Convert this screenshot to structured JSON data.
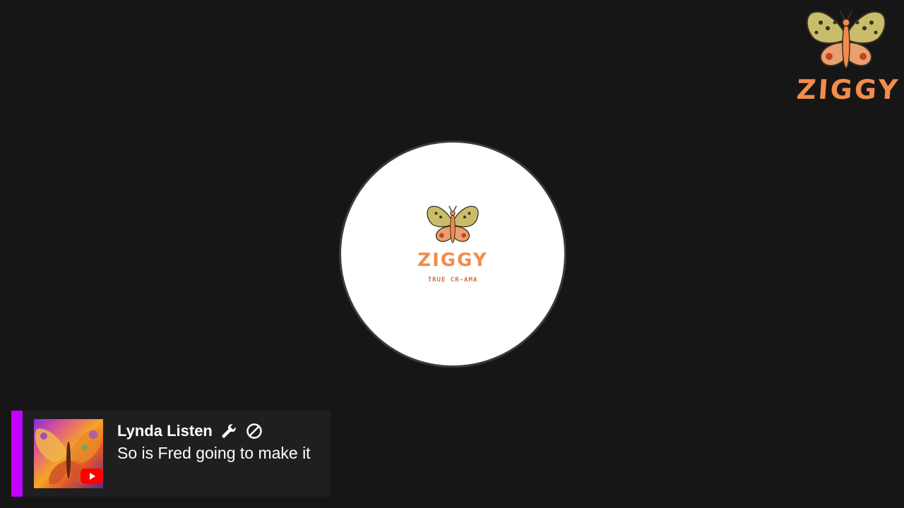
{
  "colors": {
    "background": "#171616",
    "brand_orange": "#f28c4c",
    "chat_accent": "#c400ff",
    "chat_background": "#1f1f1f",
    "youtube_red": "#ff0000"
  },
  "corner_logo": {
    "icon": "butterfly-icon",
    "brand": "ZIGGY"
  },
  "center_avatar": {
    "icon": "butterfly-icon",
    "brand": "ZIGGY",
    "tagline": "TRUE CR-AMA"
  },
  "chat": {
    "author": "Lynda Listen",
    "badges": [
      "wrench-icon",
      "blocked-icon"
    ],
    "message": "So is Fred going to make it",
    "platform_icon": "youtube-icon"
  }
}
